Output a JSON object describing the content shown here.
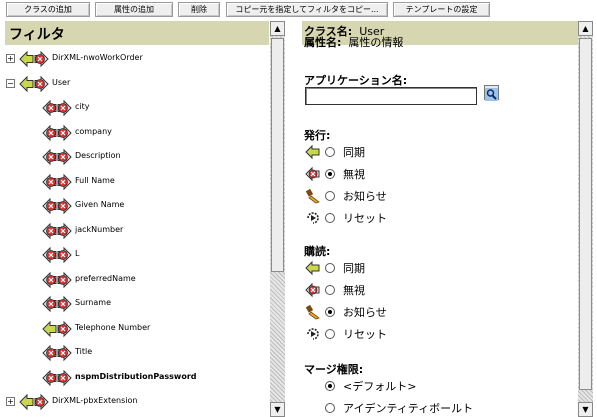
{
  "toolbar": {
    "add_class": "クラスの追加",
    "add_attribute": "属性の追加",
    "delete": "削除",
    "copy_filter": "コピー元を指定してフィルタをコピー...",
    "template_settings": "テンプレートの設定"
  },
  "filter_panel": {
    "title": "フィルタ",
    "tree": [
      {
        "label": "DirXML-nwoWorkOrder",
        "level": 0,
        "expander": "+",
        "icon": "sync-ignore"
      },
      {
        "label": "User",
        "level": 0,
        "expander": "−",
        "icon": "sync-ignore"
      },
      {
        "label": "city",
        "level": 1,
        "icon": "ignore-ignore"
      },
      {
        "label": "company",
        "level": 1,
        "icon": "ignore-ignore"
      },
      {
        "label": "Description",
        "level": 1,
        "icon": "ignore-ignore"
      },
      {
        "label": "Full Name",
        "level": 1,
        "icon": "ignore-ignore"
      },
      {
        "label": "Given Name",
        "level": 1,
        "icon": "ignore-ignore"
      },
      {
        "label": "jackNumber",
        "level": 1,
        "icon": "ignore-ignore"
      },
      {
        "label": "L",
        "level": 1,
        "icon": "ignore-ignore"
      },
      {
        "label": "preferredName",
        "level": 1,
        "icon": "ignore-ignore"
      },
      {
        "label": "Surname",
        "level": 1,
        "icon": "ignore-ignore"
      },
      {
        "label": "Telephone Number",
        "level": 1,
        "icon": "sync-ignore"
      },
      {
        "label": "Title",
        "level": 1,
        "icon": "ignore-ignore"
      },
      {
        "label": "nspmDistributionPassword",
        "level": 1,
        "icon": "ignore-ignore",
        "bold": true
      },
      {
        "label": "DirXML-pbxExtension",
        "level": 0,
        "expander": "+",
        "icon": "sync-ignore"
      }
    ]
  },
  "details_panel": {
    "class_name_label": "クラス名:",
    "class_name_value": "User",
    "attribute_name_label": "属性名:",
    "attribute_name_value": "属性の情報",
    "app_name_label": "アプリケーション名:",
    "app_name_value": "",
    "publish": {
      "title": "発行:",
      "options": [
        {
          "label": "同期",
          "icon": "sync-icon",
          "selected": false
        },
        {
          "label": "無視",
          "icon": "ignore-icon",
          "selected": true
        },
        {
          "label": "お知らせ",
          "icon": "notify-icon",
          "selected": false
        },
        {
          "label": "リセット",
          "icon": "reset-icon",
          "selected": false
        }
      ]
    },
    "subscribe": {
      "title": "購読:",
      "options": [
        {
          "label": "同期",
          "icon": "sync-icon",
          "selected": false
        },
        {
          "label": "無視",
          "icon": "ignore-icon",
          "selected": false
        },
        {
          "label": "お知らせ",
          "icon": "notify-icon",
          "selected": true
        },
        {
          "label": "リセット",
          "icon": "reset-icon",
          "selected": false
        }
      ]
    },
    "merge": {
      "title": "マージ権限:",
      "options": [
        {
          "label": "<デフォルト>",
          "selected": true
        },
        {
          "label": "アイデンティティボールト",
          "selected": false
        }
      ]
    }
  },
  "colors": {
    "header_bg": "#d6d6b0",
    "sync_green": "#c8d84a",
    "ignore_red": "#d83030"
  }
}
